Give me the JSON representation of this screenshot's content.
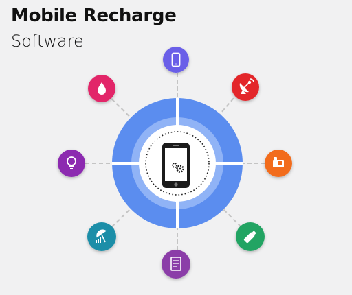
{
  "title": "Mobile Recharge",
  "subtitle": "Software",
  "colors": {
    "background": "#f1f1f2",
    "ring_outer": "#5b8def",
    "ring_inner": "#90b3f6",
    "core": "#ffffff",
    "connector": "#c4c4c4"
  },
  "hub": {
    "icon": "smartphone-gears-icon"
  },
  "services": [
    {
      "name": "mobile",
      "icon": "mobile-phone-icon",
      "color": "#6a5ee8"
    },
    {
      "name": "dth",
      "icon": "satellite-dish-icon",
      "color": "#e3262b"
    },
    {
      "name": "landline",
      "icon": "landline-phone-icon",
      "color": "#f26c1d"
    },
    {
      "name": "datacard",
      "icon": "usb-datacard-icon",
      "color": "#23a463"
    },
    {
      "name": "bill-payment",
      "icon": "bill-receipt-icon",
      "color": "#8b3ea8"
    },
    {
      "name": "insurance",
      "icon": "umbrella-insurance-icon",
      "color": "#1a8ea8"
    },
    {
      "name": "electricity",
      "icon": "light-bulb-icon",
      "color": "#8c2cb0"
    },
    {
      "name": "water",
      "icon": "water-drop-icon",
      "color": "#e22769"
    }
  ]
}
